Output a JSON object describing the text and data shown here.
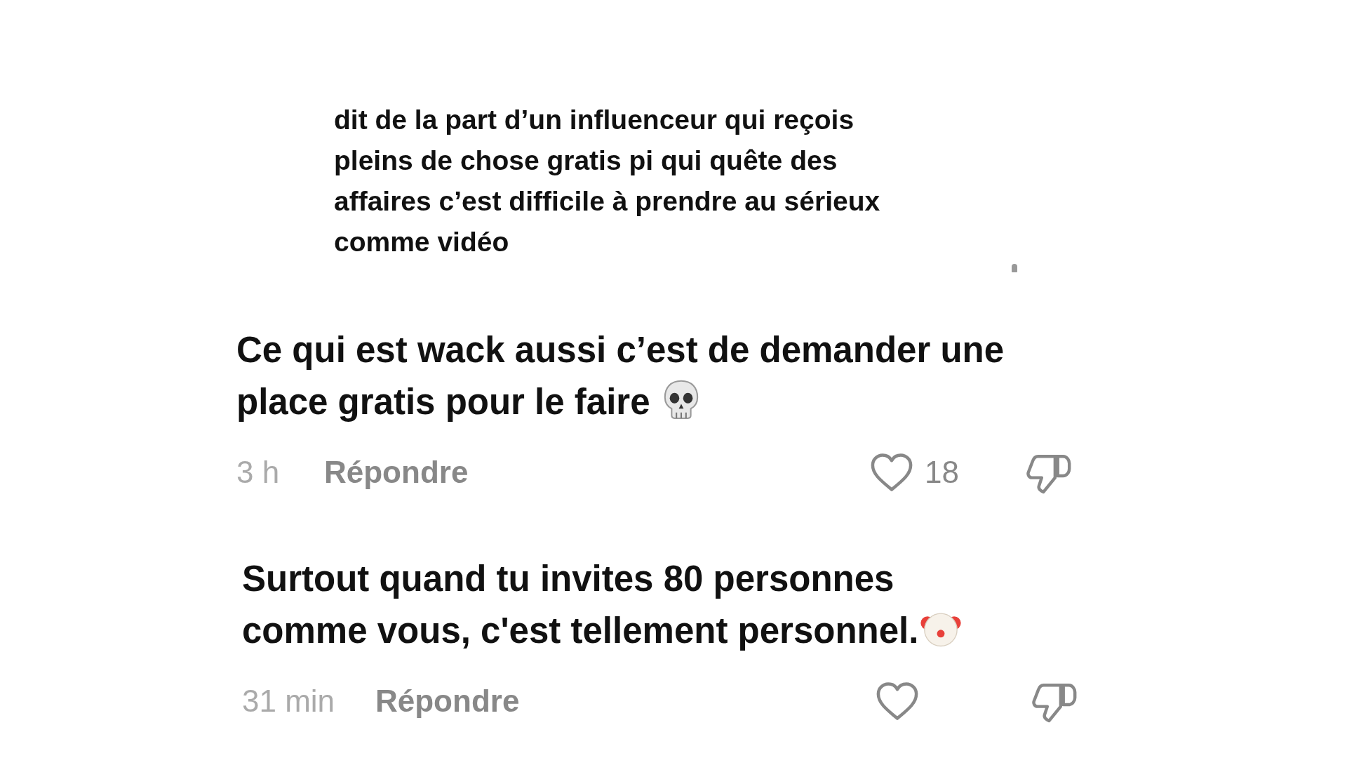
{
  "quoted_comment": {
    "text": "dit de la part d’un influenceur qui reçois\npleins de chose gratis pi qui quête des\naffaires c’est difficile à prendre au sérieux\ncomme vidéo"
  },
  "comments": [
    {
      "text": "Ce qui est wack aussi c’est de demander une\nplace gratis pour le faire",
      "emoji": {
        "kind": "skull"
      },
      "time": "3 h",
      "reply": "Répondre",
      "liked": false,
      "likes": "18",
      "disliked": false
    },
    {
      "text": "Surtout quand tu invites 80 personnes\ncomme vous, c'est tellement personnel.",
      "emoji": {
        "kind": "clown"
      },
      "time": "31 min",
      "reply": "Répondre",
      "liked": false,
      "disliked": false
    }
  ]
}
